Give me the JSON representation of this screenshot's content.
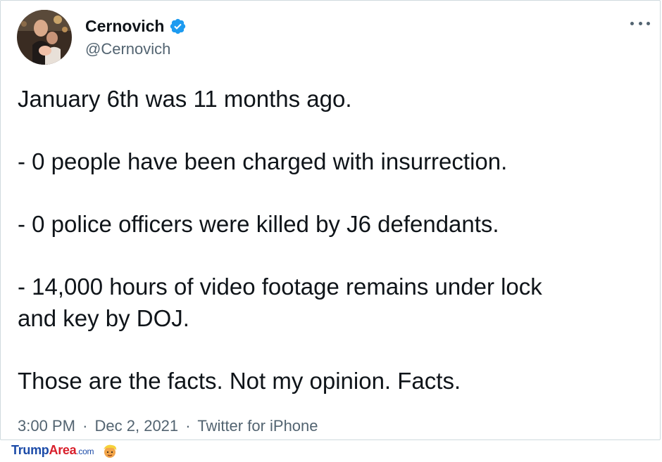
{
  "author": {
    "name": "Cernovich",
    "handle": "@Cernovich",
    "verified": true,
    "verified_color": "#1d9bf0"
  },
  "tweet": {
    "lines": [
      "January 6th was 11 months ago.",
      "- 0 people have been charged with insurrection.",
      "- 0 police officers were killed by J6 defendants.",
      "- 14,000 hours of video footage remains under lock",
      "and key by DOJ.",
      "Those are the facts. Not my opinion. Facts."
    ]
  },
  "meta": {
    "time": "3:00 PM",
    "separator": "·",
    "date": "Dec 2, 2021",
    "source": "Twitter for iPhone"
  },
  "watermark": {
    "part1": "Trump",
    "part2": "Area",
    "part3": ".com",
    "logo_icon": "trump-face-icon"
  },
  "colors": {
    "text": "#0f1419",
    "secondary": "#536471",
    "border": "#cfd9de"
  }
}
